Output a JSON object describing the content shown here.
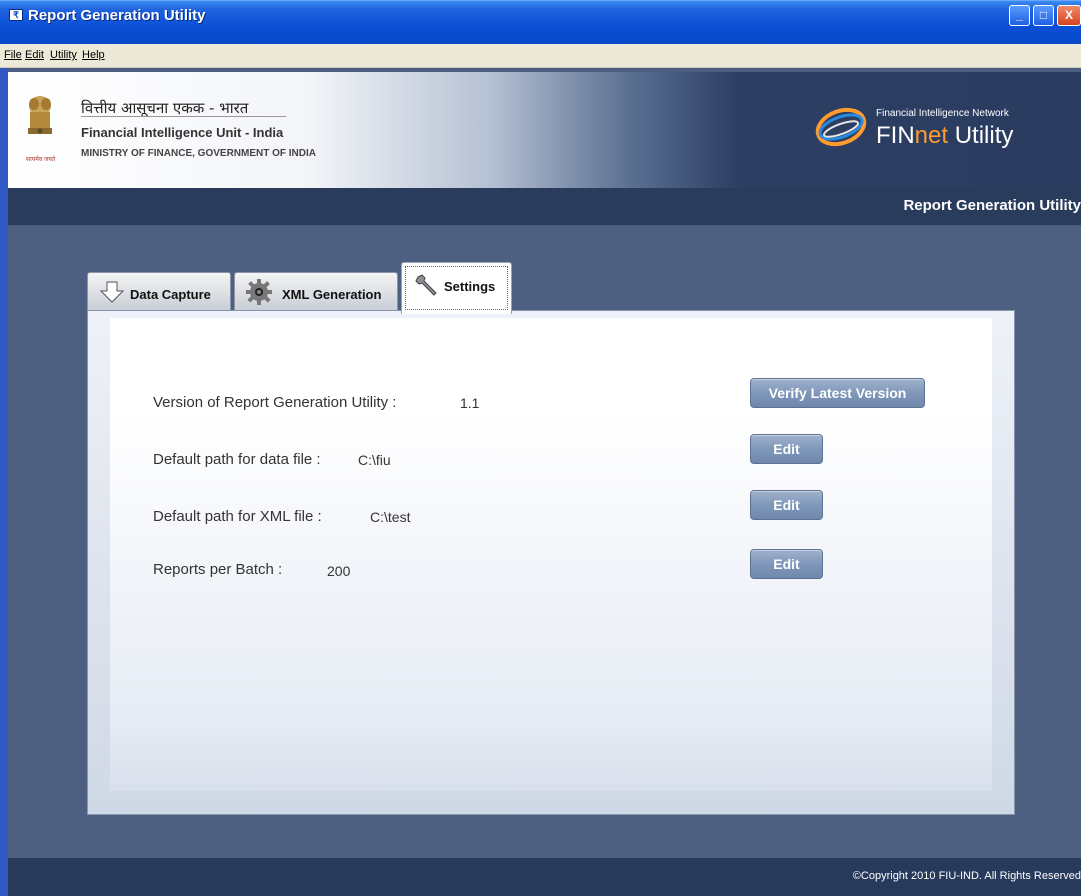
{
  "window": {
    "title": "Report Generation Utility",
    "controls": {
      "minimize": "_",
      "maximize": "□",
      "close": "X"
    }
  },
  "menu": {
    "items": [
      "File",
      "Edit",
      "Utility",
      "Help"
    ]
  },
  "banner": {
    "hindi_title": "वित्तीय आसूचना एकक - भारत",
    "org_name": "Financial Intelligence Unit - India",
    "ministry": "MINISTRY OF FINANCE, GOVERNMENT OF INDIA",
    "emblem_motto": "सत्यमेव जयते",
    "network_label": "Financial Intelligence Network",
    "product_fin": "FIN",
    "product_net": "net",
    "product_utility": " Utility"
  },
  "subheader": {
    "title": "Report Generation Utility"
  },
  "tabs": [
    {
      "label": "Data Capture",
      "icon": "down-arrow-icon",
      "active": false
    },
    {
      "label": "XML Generation",
      "icon": "gear-icon",
      "active": false
    },
    {
      "label": "Settings",
      "icon": "wrench-icon",
      "active": true
    }
  ],
  "settings": {
    "version_label": "Version of Report Generation Utility :",
    "version_value": "1.1",
    "verify_button": "Verify Latest Version",
    "data_path_label": "Default path for data file :",
    "data_path_value": "C:\\fiu",
    "xml_path_label": "Default path for XML file :",
    "xml_path_value": "C:\\test",
    "batch_label": "Reports per Batch :",
    "batch_value": "200",
    "edit_button": "Edit"
  },
  "footer": {
    "copyright": "©Copyright 2010 FIU-IND. All Rights Reserved"
  },
  "colors": {
    "title_bar": "#0b4fd6",
    "dark_strip": "#2a3c5c",
    "button": "#7f97b9",
    "accent_orange": "#ff9a2e"
  }
}
